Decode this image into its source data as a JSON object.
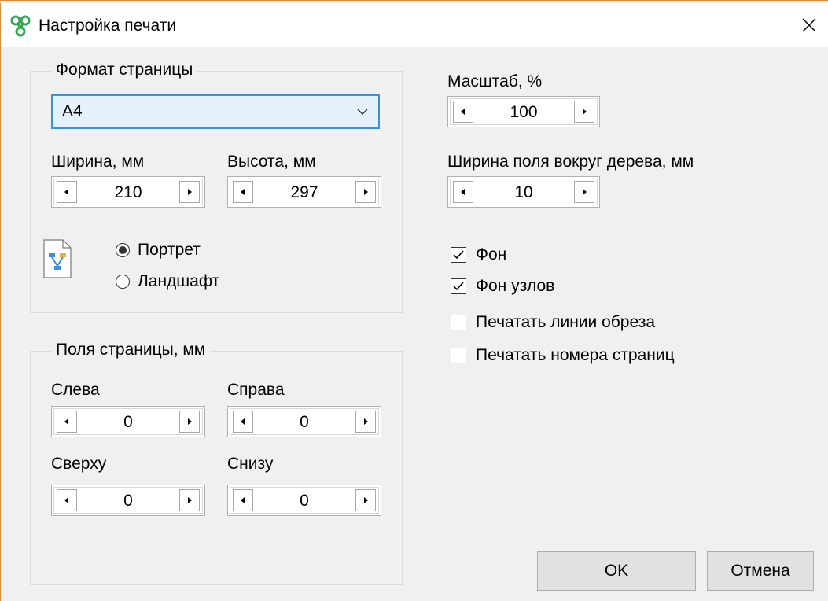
{
  "window": {
    "title": "Настройка печати"
  },
  "page_format": {
    "group_label": "Формат страницы",
    "format_value": "A4",
    "width_label": "Ширина, мм",
    "width_value": "210",
    "height_label": "Высота, мм",
    "height_value": "297",
    "orientation": {
      "portrait_label": "Портрет",
      "landscape_label": "Ландшафт",
      "selected": "portrait"
    }
  },
  "margins": {
    "group_label": "Поля страницы, мм",
    "left_label": "Слева",
    "left_value": "0",
    "right_label": "Справа",
    "right_value": "0",
    "top_label": "Сверху",
    "top_value": "0",
    "bottom_label": "Снизу",
    "bottom_value": "0"
  },
  "scale": {
    "label": "Масштаб, %",
    "value": "100"
  },
  "tree_margin": {
    "label": "Ширина поля вокруг дерева, мм",
    "value": "10"
  },
  "options": [
    {
      "label": "Фон",
      "checked": true
    },
    {
      "label": "Фон узлов",
      "checked": true
    },
    {
      "label": "Печатать линии обреза",
      "checked": false
    },
    {
      "label": "Печатать номера страниц",
      "checked": false
    }
  ],
  "buttons": {
    "ok": "OK",
    "cancel": "Отмена"
  },
  "colors": {
    "accent": "#3c8fd8",
    "combo_bg": "#e5f1fb",
    "dialog_bg": "#f0f0f0",
    "app_icon": "#2fa84f"
  },
  "icons": [
    "app-icon",
    "close-icon",
    "chevron-down-icon",
    "arrow-left-icon",
    "arrow-right-icon",
    "page-orientation-icon",
    "checkmark-icon"
  ]
}
